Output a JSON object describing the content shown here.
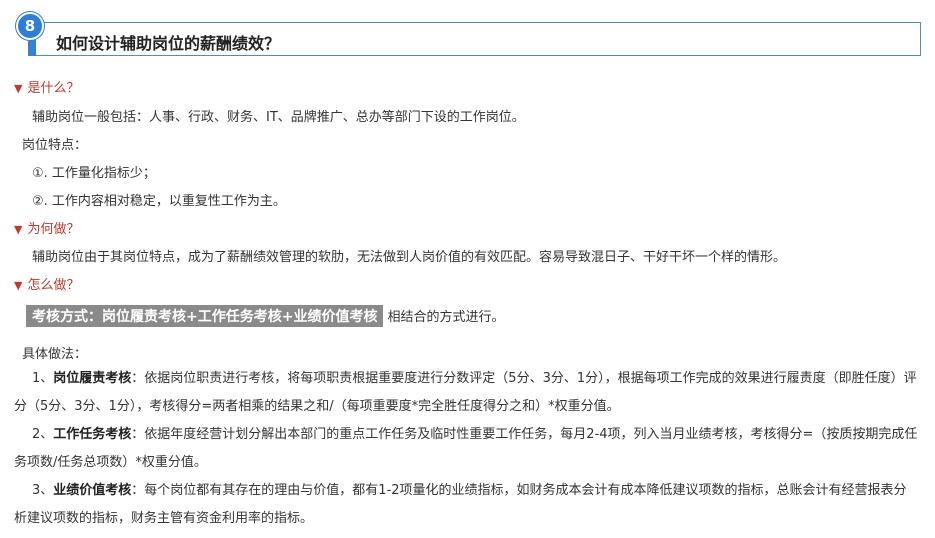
{
  "header": {
    "number": "8",
    "title": "如何设计辅助岗位的薪酬绩效？"
  },
  "sections": {
    "what": "是什么？",
    "why": "为何做？",
    "how": "怎么做？"
  },
  "what_content": {
    "intro": "辅助岗位一般包括：人事、行政、财务、IT、品牌推广、总办等部门下设的工作岗位。",
    "features_label": "岗位特点：",
    "feature_1": "①. 工作量化指标少；",
    "feature_2": "②. 工作内容相对稳定，以重复性工作为主。"
  },
  "why_content": {
    "text": "辅助岗位由于其岗位特点，成为了薪酬绩效管理的软肋，无法做到人岗价值的有效匹配。容易导致混日子、干好干坏一个样的情形。"
  },
  "how_content": {
    "highlight": "考核方式：岗位履责考核+工作任务考核+业绩价值考核",
    "highlight_suffix": "相结合的方式进行。",
    "method_label": "具体做法：",
    "items": [
      {
        "prefix": "1、",
        "name": "岗位履责考核",
        "text": "：依据岗位职责进行考核，将每项职责根据重要度进行分数评定（5分、3分、1分），根据每项工作完成的效果进行履责度（即胜任度）评分（5分、3分、1分），考核得分=两者相乘的结果之和/（每项重要度*完全胜任度得分之和）*权重分值。"
      },
      {
        "prefix": "2、",
        "name": "工作任务考核",
        "text": "：依据年度经营计划分解出本部门的重点工作任务及临时性重要工作任务，每月2-4项，列入当月业绩考核，考核得分=（按质按期完成任务项数/任务总项数）*权重分值。"
      },
      {
        "prefix": "3、",
        "name": "业绩价值考核",
        "text": "：每个岗位都有其存在的理由与价值，都有1-2项量化的业绩指标，如财务成本会计有成本降低建议项数的指标，总账会计有经营报表分析建议项数的指标，财务主管有资金利用率的指标。"
      }
    ]
  },
  "colors": {
    "accent_blue": "#2f7ed6",
    "section_red": "#c0392b",
    "highlight_gray": "#8a8a8a"
  }
}
